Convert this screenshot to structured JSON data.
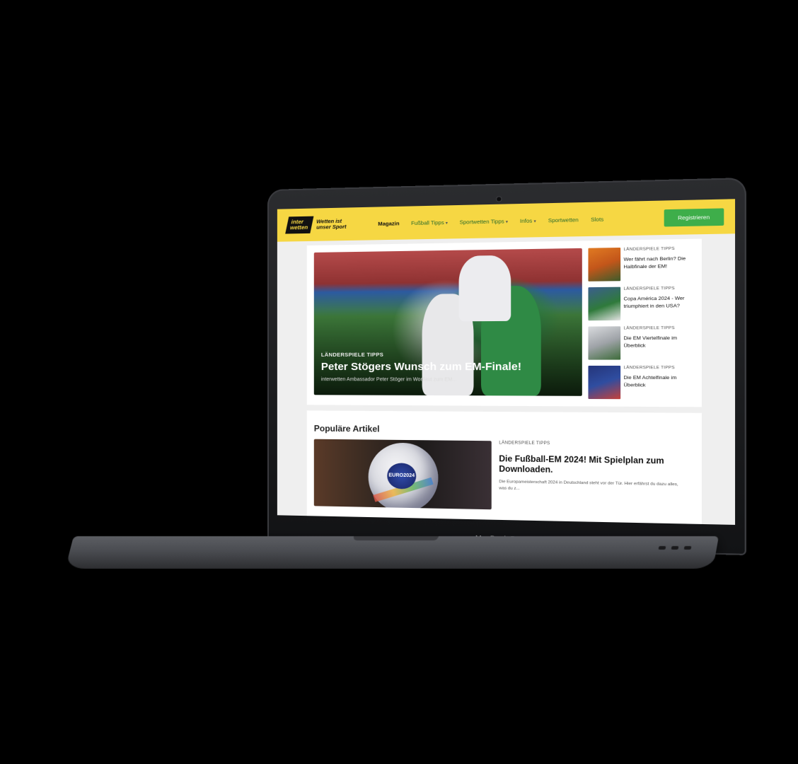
{
  "device": {
    "label": "MacBook Pro"
  },
  "header": {
    "logo": {
      "line1": "inter",
      "line2": "wetten",
      "tagline": "Wetten ist unser Sport"
    },
    "nav": [
      {
        "label": "Magazin",
        "has_dropdown": false,
        "active": true
      },
      {
        "label": "Fußball Tipps",
        "has_dropdown": true
      },
      {
        "label": "Sportwetten Tipps",
        "has_dropdown": true
      },
      {
        "label": "Infos",
        "has_dropdown": true
      },
      {
        "label": "Sportwetten",
        "has_dropdown": false
      },
      {
        "label": "Slots",
        "has_dropdown": false
      }
    ],
    "register_label": "Registrieren",
    "accent_color": "#f6d743",
    "button_color": "#3eae4a"
  },
  "hero": {
    "category": "LÄNDERSPIELE TIPPS",
    "title": "Peter Stögers Wunsch zum EM-Finale!",
    "subtitle": "interwetten Ambassador Peter Stöger im Wortlaut zum EM..."
  },
  "side_articles": [
    {
      "category": "LÄNDERSPIELE TIPPS",
      "title": "Wer fährt nach Berlin? Die Halbfinale der EM!"
    },
    {
      "category": "LÄNDERSPIELE TIPPS",
      "title": "Copa América 2024 - Wer triumphiert in den USA?"
    },
    {
      "category": "LÄNDERSPIELE TIPPS",
      "title": "Die EM Viertelfinale im Überblick"
    },
    {
      "category": "LÄNDERSPIELE TIPPS",
      "title": "Die EM Achtelfinale im Überblick"
    }
  ],
  "popular": {
    "section_title": "Populäre Artikel",
    "article": {
      "category": "LÄNDERSPIELE TIPPS",
      "title": "Die Fußball-EM 2024! Mit Spielplan zum Downloaden.",
      "description": "Die Europameisterschaft 2024 in Deutschland steht vor der Tür. Hier erfährst du dazu alles, was du z...",
      "image_text": "EURO2024"
    }
  }
}
